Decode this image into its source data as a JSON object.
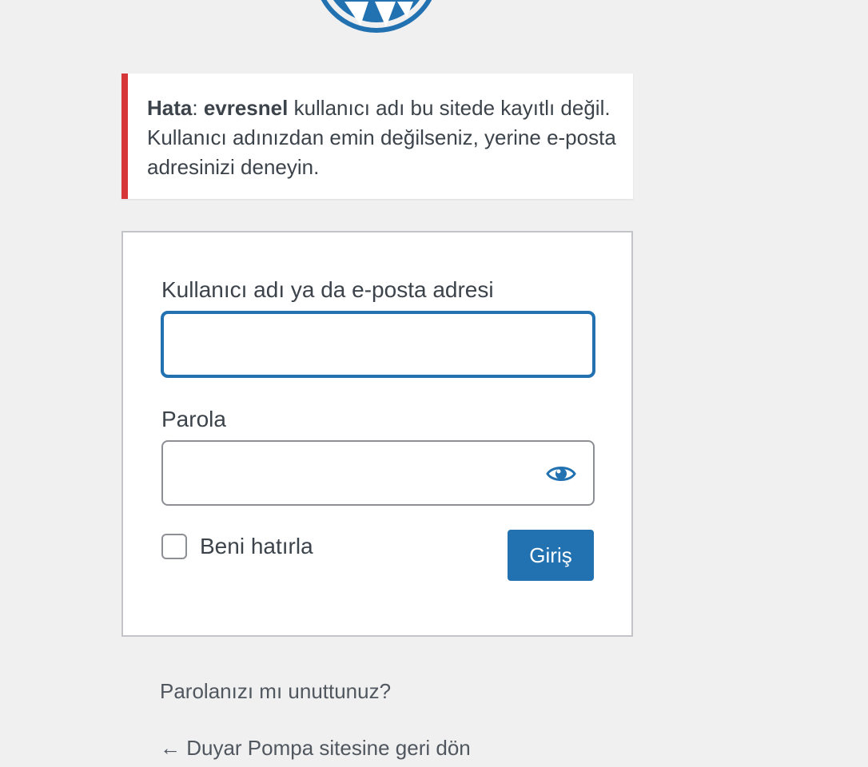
{
  "logo": {
    "icon": "wordpress-logo-icon",
    "color": "#2271b1"
  },
  "notice": {
    "prefix_strong": "Hata",
    "separator": ": ",
    "username_strong": "evresnel",
    "message": " kullanıcı adı bu sitede kayıtlı değil. Kullanıcı adınızdan emin değilseniz, yerine e-posta adresinizi deneyin.",
    "border_color": "#d63638"
  },
  "form": {
    "username_label": "Kullanıcı adı ya da e-posta adresi",
    "username_value": "",
    "password_label": "Parola",
    "password_value": "",
    "show_password_icon": "eye-icon",
    "remember_label": "Beni hatırla",
    "remember_checked": false,
    "submit_label": "Giriş"
  },
  "links": {
    "lost_password": "Parolanızı mı unuttunuz?",
    "back_to_blog": "← Duyar Pompa sitesine geri dön"
  },
  "colors": {
    "accent": "#2271b1",
    "background": "#f0f0f1",
    "text": "#3c434a"
  }
}
